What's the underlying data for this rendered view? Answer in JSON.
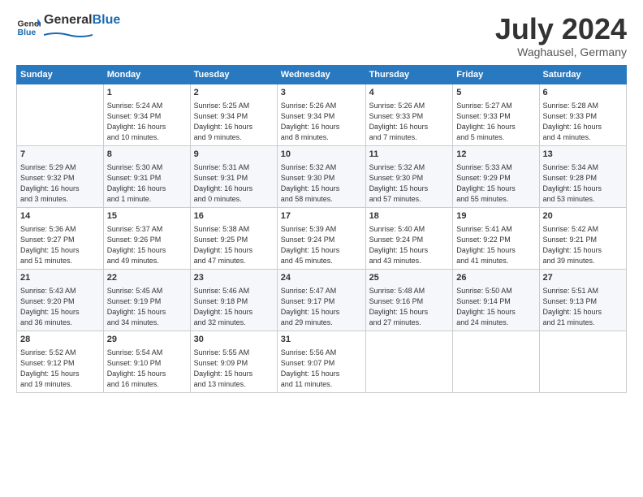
{
  "header": {
    "logo_general": "General",
    "logo_blue": "Blue",
    "month": "July 2024",
    "location": "Waghausel, Germany"
  },
  "days_of_week": [
    "Sunday",
    "Monday",
    "Tuesday",
    "Wednesday",
    "Thursday",
    "Friday",
    "Saturday"
  ],
  "weeks": [
    [
      {
        "day": "",
        "info": ""
      },
      {
        "day": "1",
        "info": "Sunrise: 5:24 AM\nSunset: 9:34 PM\nDaylight: 16 hours\nand 10 minutes."
      },
      {
        "day": "2",
        "info": "Sunrise: 5:25 AM\nSunset: 9:34 PM\nDaylight: 16 hours\nand 9 minutes."
      },
      {
        "day": "3",
        "info": "Sunrise: 5:26 AM\nSunset: 9:34 PM\nDaylight: 16 hours\nand 8 minutes."
      },
      {
        "day": "4",
        "info": "Sunrise: 5:26 AM\nSunset: 9:33 PM\nDaylight: 16 hours\nand 7 minutes."
      },
      {
        "day": "5",
        "info": "Sunrise: 5:27 AM\nSunset: 9:33 PM\nDaylight: 16 hours\nand 5 minutes."
      },
      {
        "day": "6",
        "info": "Sunrise: 5:28 AM\nSunset: 9:33 PM\nDaylight: 16 hours\nand 4 minutes."
      }
    ],
    [
      {
        "day": "7",
        "info": "Sunrise: 5:29 AM\nSunset: 9:32 PM\nDaylight: 16 hours\nand 3 minutes."
      },
      {
        "day": "8",
        "info": "Sunrise: 5:30 AM\nSunset: 9:31 PM\nDaylight: 16 hours\nand 1 minute."
      },
      {
        "day": "9",
        "info": "Sunrise: 5:31 AM\nSunset: 9:31 PM\nDaylight: 16 hours\nand 0 minutes."
      },
      {
        "day": "10",
        "info": "Sunrise: 5:32 AM\nSunset: 9:30 PM\nDaylight: 15 hours\nand 58 minutes."
      },
      {
        "day": "11",
        "info": "Sunrise: 5:32 AM\nSunset: 9:30 PM\nDaylight: 15 hours\nand 57 minutes."
      },
      {
        "day": "12",
        "info": "Sunrise: 5:33 AM\nSunset: 9:29 PM\nDaylight: 15 hours\nand 55 minutes."
      },
      {
        "day": "13",
        "info": "Sunrise: 5:34 AM\nSunset: 9:28 PM\nDaylight: 15 hours\nand 53 minutes."
      }
    ],
    [
      {
        "day": "14",
        "info": "Sunrise: 5:36 AM\nSunset: 9:27 PM\nDaylight: 15 hours\nand 51 minutes."
      },
      {
        "day": "15",
        "info": "Sunrise: 5:37 AM\nSunset: 9:26 PM\nDaylight: 15 hours\nand 49 minutes."
      },
      {
        "day": "16",
        "info": "Sunrise: 5:38 AM\nSunset: 9:25 PM\nDaylight: 15 hours\nand 47 minutes."
      },
      {
        "day": "17",
        "info": "Sunrise: 5:39 AM\nSunset: 9:24 PM\nDaylight: 15 hours\nand 45 minutes."
      },
      {
        "day": "18",
        "info": "Sunrise: 5:40 AM\nSunset: 9:24 PM\nDaylight: 15 hours\nand 43 minutes."
      },
      {
        "day": "19",
        "info": "Sunrise: 5:41 AM\nSunset: 9:22 PM\nDaylight: 15 hours\nand 41 minutes."
      },
      {
        "day": "20",
        "info": "Sunrise: 5:42 AM\nSunset: 9:21 PM\nDaylight: 15 hours\nand 39 minutes."
      }
    ],
    [
      {
        "day": "21",
        "info": "Sunrise: 5:43 AM\nSunset: 9:20 PM\nDaylight: 15 hours\nand 36 minutes."
      },
      {
        "day": "22",
        "info": "Sunrise: 5:45 AM\nSunset: 9:19 PM\nDaylight: 15 hours\nand 34 minutes."
      },
      {
        "day": "23",
        "info": "Sunrise: 5:46 AM\nSunset: 9:18 PM\nDaylight: 15 hours\nand 32 minutes."
      },
      {
        "day": "24",
        "info": "Sunrise: 5:47 AM\nSunset: 9:17 PM\nDaylight: 15 hours\nand 29 minutes."
      },
      {
        "day": "25",
        "info": "Sunrise: 5:48 AM\nSunset: 9:16 PM\nDaylight: 15 hours\nand 27 minutes."
      },
      {
        "day": "26",
        "info": "Sunrise: 5:50 AM\nSunset: 9:14 PM\nDaylight: 15 hours\nand 24 minutes."
      },
      {
        "day": "27",
        "info": "Sunrise: 5:51 AM\nSunset: 9:13 PM\nDaylight: 15 hours\nand 21 minutes."
      }
    ],
    [
      {
        "day": "28",
        "info": "Sunrise: 5:52 AM\nSunset: 9:12 PM\nDaylight: 15 hours\nand 19 minutes."
      },
      {
        "day": "29",
        "info": "Sunrise: 5:54 AM\nSunset: 9:10 PM\nDaylight: 15 hours\nand 16 minutes."
      },
      {
        "day": "30",
        "info": "Sunrise: 5:55 AM\nSunset: 9:09 PM\nDaylight: 15 hours\nand 13 minutes."
      },
      {
        "day": "31",
        "info": "Sunrise: 5:56 AM\nSunset: 9:07 PM\nDaylight: 15 hours\nand 11 minutes."
      },
      {
        "day": "",
        "info": ""
      },
      {
        "day": "",
        "info": ""
      },
      {
        "day": "",
        "info": ""
      }
    ]
  ]
}
